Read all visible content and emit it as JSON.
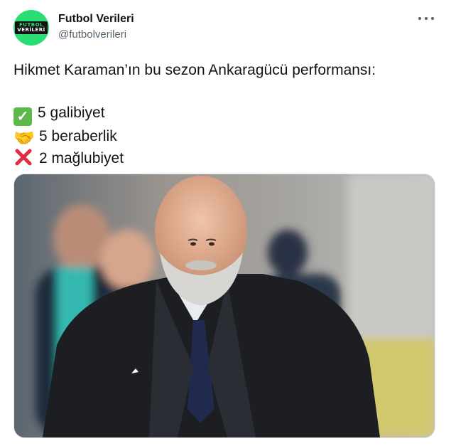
{
  "tweet": {
    "author_name": "Futbol Verileri",
    "author_handle": "@futbolverileri",
    "avatar_logo": {
      "top": "FUTBOL",
      "bottom": "VERİLERİ"
    },
    "text_lines": [
      "Hikmet Karaman’ın bu sezon Ankaragücü performansı:",
      "5 galibiyet",
      "5 beraberlik",
      "2 mağlubiyet"
    ],
    "emoji_names": [
      "check-mark-emoji",
      "handshake-emoji",
      "cross-mark-emoji"
    ],
    "photo_icon": "coach-photo"
  },
  "colors": {
    "brand_green": "#2bde73",
    "text": "#0f1419",
    "secondary": "#536471"
  }
}
